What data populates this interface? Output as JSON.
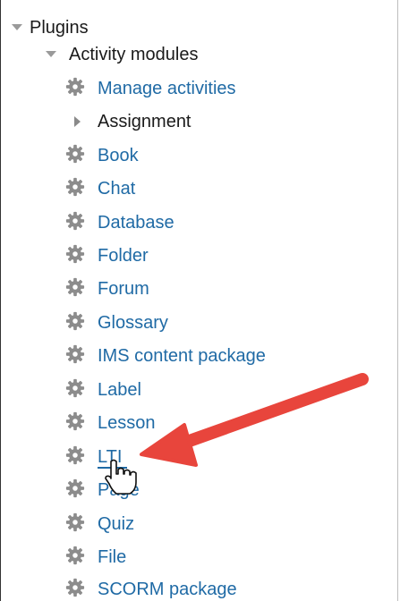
{
  "tree": {
    "root_label": "Plugins",
    "group_label": "Activity modules",
    "items": [
      {
        "label": "Manage activities",
        "icon": "gear-icon",
        "link": true
      },
      {
        "label": "Assignment",
        "icon": "expand-triangle-icon",
        "link": false
      },
      {
        "label": "Book",
        "icon": "gear-icon",
        "link": true
      },
      {
        "label": "Chat",
        "icon": "gear-icon",
        "link": true
      },
      {
        "label": "Database",
        "icon": "gear-icon",
        "link": true
      },
      {
        "label": "Folder",
        "icon": "gear-icon",
        "link": true
      },
      {
        "label": "Forum",
        "icon": "gear-icon",
        "link": true
      },
      {
        "label": "Glossary",
        "icon": "gear-icon",
        "link": true
      },
      {
        "label": "IMS content package",
        "icon": "gear-icon",
        "link": true
      },
      {
        "label": "Label",
        "icon": "gear-icon",
        "link": true
      },
      {
        "label": "Lesson",
        "icon": "gear-icon",
        "link": true
      },
      {
        "label": "LTI",
        "icon": "gear-icon",
        "link": true
      },
      {
        "label": "Page",
        "icon": "gear-icon",
        "link": true
      },
      {
        "label": "Quiz",
        "icon": "gear-icon",
        "link": true
      },
      {
        "label": "File",
        "icon": "gear-icon",
        "link": true
      },
      {
        "label": "SCORM package",
        "icon": "gear-icon",
        "link": true
      }
    ]
  },
  "colors": {
    "link": "#1f6aa5",
    "text": "#1a1a1a",
    "arrow": "#e8453c",
    "gear": "#8c8c8c"
  },
  "annotation": {
    "arrow_target": "LTI",
    "cursor": "hand-pointer-icon"
  }
}
